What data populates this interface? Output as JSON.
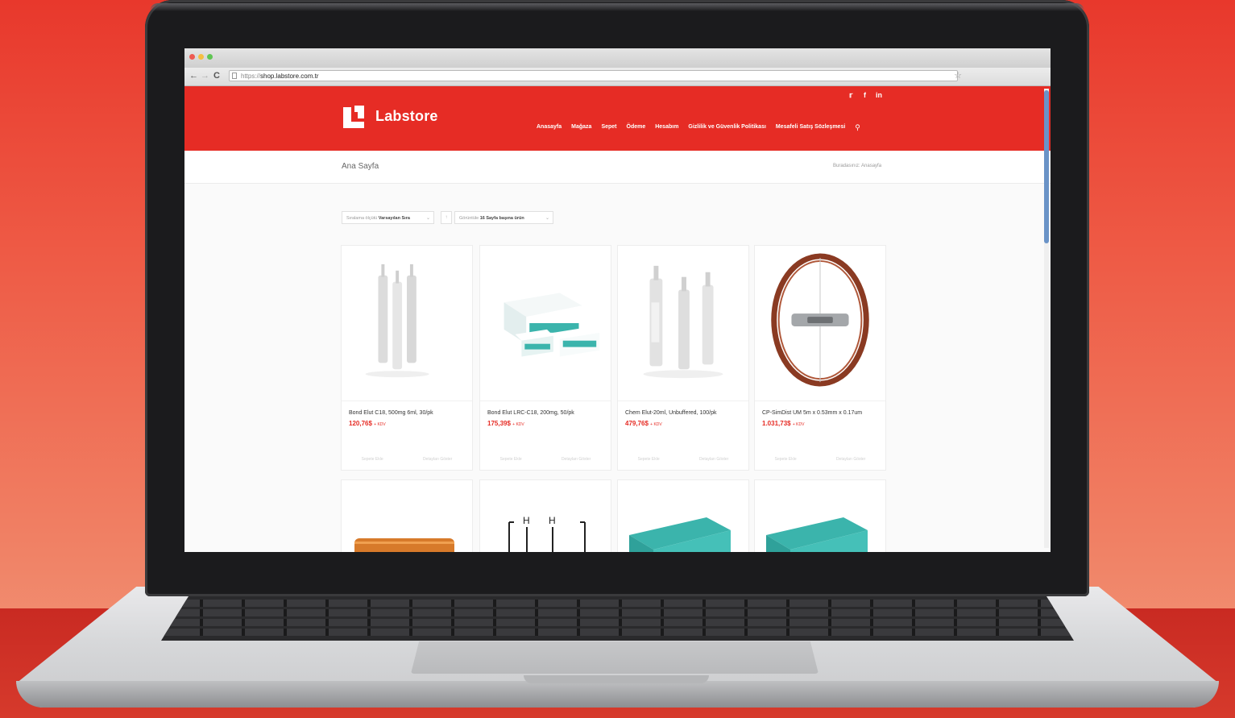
{
  "browser": {
    "url_scheme": "https://",
    "url_host": "shop.labstore.com.tr"
  },
  "site": {
    "brand": "Labstore",
    "brand_color": "#e62c25",
    "social": [
      "twitter-icon",
      "facebook-icon",
      "linkedin-icon"
    ],
    "menu": [
      "Anasayfa",
      "Mağaza",
      "Sepet",
      "Ödeme",
      "Hesabım",
      "Gizlilik ve Güvenlik Politikası",
      "Mesafeli Satış Sözleşmesi"
    ]
  },
  "breadcrumb": {
    "title": "Ana Sayfa",
    "trail_prefix": "Buradasınız:",
    "trail_current": "Anasayfa"
  },
  "toolbar": {
    "sort_prefix": "Sıralama ölçütü",
    "sort_value": "Varsayılan Sıra",
    "view_prefix": "Görüntüle",
    "view_value": "16 Sayfa başına ürün"
  },
  "products": [
    {
      "name": "Bond Elut C18, 500mg 6ml, 30/pk",
      "price": "120,76$",
      "tax": "+ KDV",
      "add_label": "Sepete Ekle",
      "details_label": "Detayları Göster"
    },
    {
      "name": "Bond Elut LRC-C18, 200mg, 50/pk",
      "price": "175,39$",
      "tax": "+ KDV",
      "add_label": "Sepete Ekle",
      "details_label": "Detayları Göster"
    },
    {
      "name": "Chem Elut-20ml, Unbuffered, 100/pk",
      "price": "479,76$",
      "tax": "+ KDV",
      "add_label": "Sepete Ekle",
      "details_label": "Detayları Göster"
    },
    {
      "name": "CP-SimDist UM 5m x 0.53mm x 0.17um",
      "price": "1.031,73$",
      "tax": "+ KDV",
      "add_label": "Sepete Ekle",
      "details_label": "Detayları Göster"
    }
  ]
}
